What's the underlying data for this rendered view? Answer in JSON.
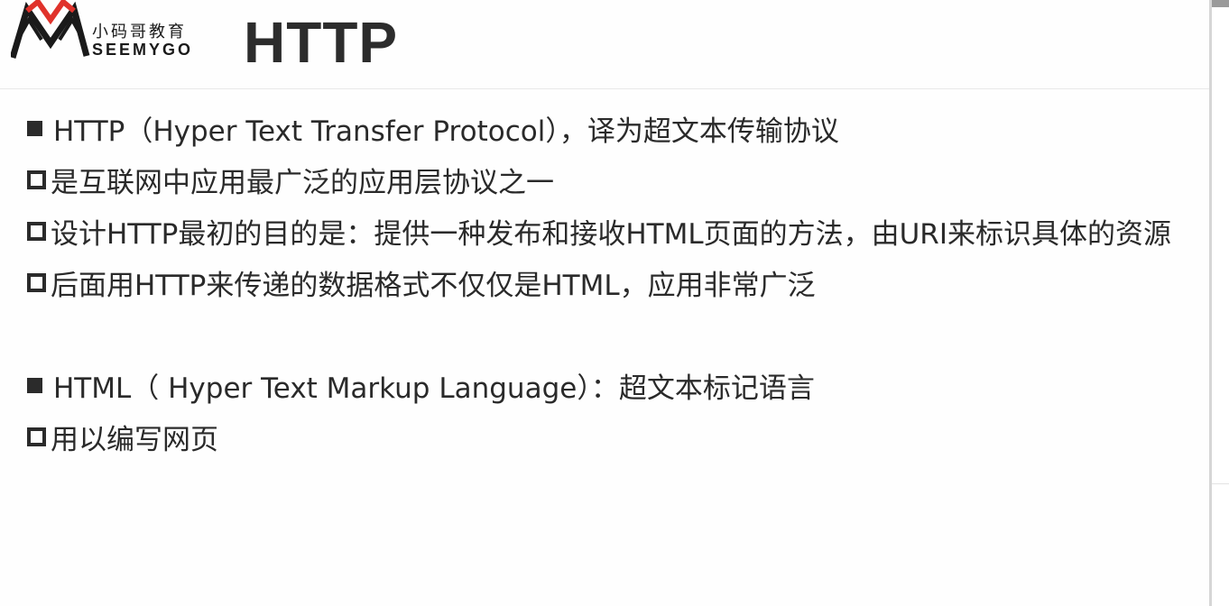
{
  "header": {
    "logo": {
      "chinese": "小码哥教育",
      "english": "SEEMYGO",
      "colors": {
        "red": "#e0322b",
        "dark": "#1a1a1a"
      }
    },
    "title": "HTTP"
  },
  "items": [
    {
      "bullet": "filled",
      "text": "HTTP（Hyper Text Transfer Protocol），译为超文本传输协议"
    },
    {
      "bullet": "hollow",
      "text": "是互联网中应用最广泛的应用层协议之一"
    },
    {
      "bullet": "hollow",
      "text": "设计HTTP最初的目的是：提供一种发布和接收HTML页面的方法，由URI来标识具体的资源"
    },
    {
      "bullet": "hollow",
      "text": "后面用HTTP来传递的数据格式不仅仅是HTML，应用非常广泛"
    },
    {
      "bullet": "filled",
      "text": "HTML（ Hyper Text Markup Language）：超文本标记语言"
    },
    {
      "bullet": "hollow",
      "text": "用以编写网页"
    }
  ]
}
